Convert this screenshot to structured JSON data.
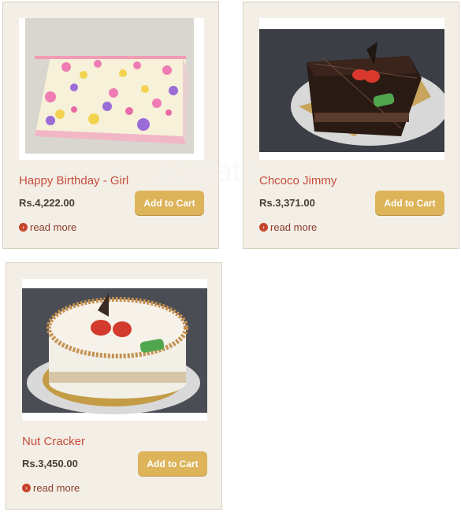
{
  "watermark": "zomato",
  "products": [
    {
      "title": "Happy Birthday - Girl",
      "price": "Rs.4,222.00",
      "add_to_cart": "Add to Cart",
      "read_more": "read more",
      "image": "cake-birthday-girl-image"
    },
    {
      "title": "Chcoco Jimmy",
      "price": "Rs.3,371.00",
      "add_to_cart": "Add to Cart",
      "read_more": "read more",
      "image": "cake-chocolate-image"
    },
    {
      "title": "Nut Cracker",
      "price": "Rs.3,450.00",
      "add_to_cart": "Add to Cart",
      "read_more": "read more",
      "image": "cake-nut-cracker-image"
    }
  ],
  "colors": {
    "card_bg": "#f3efe6",
    "title": "#c74c3c",
    "button": "#ddb45a",
    "price": "#4a3d33"
  }
}
